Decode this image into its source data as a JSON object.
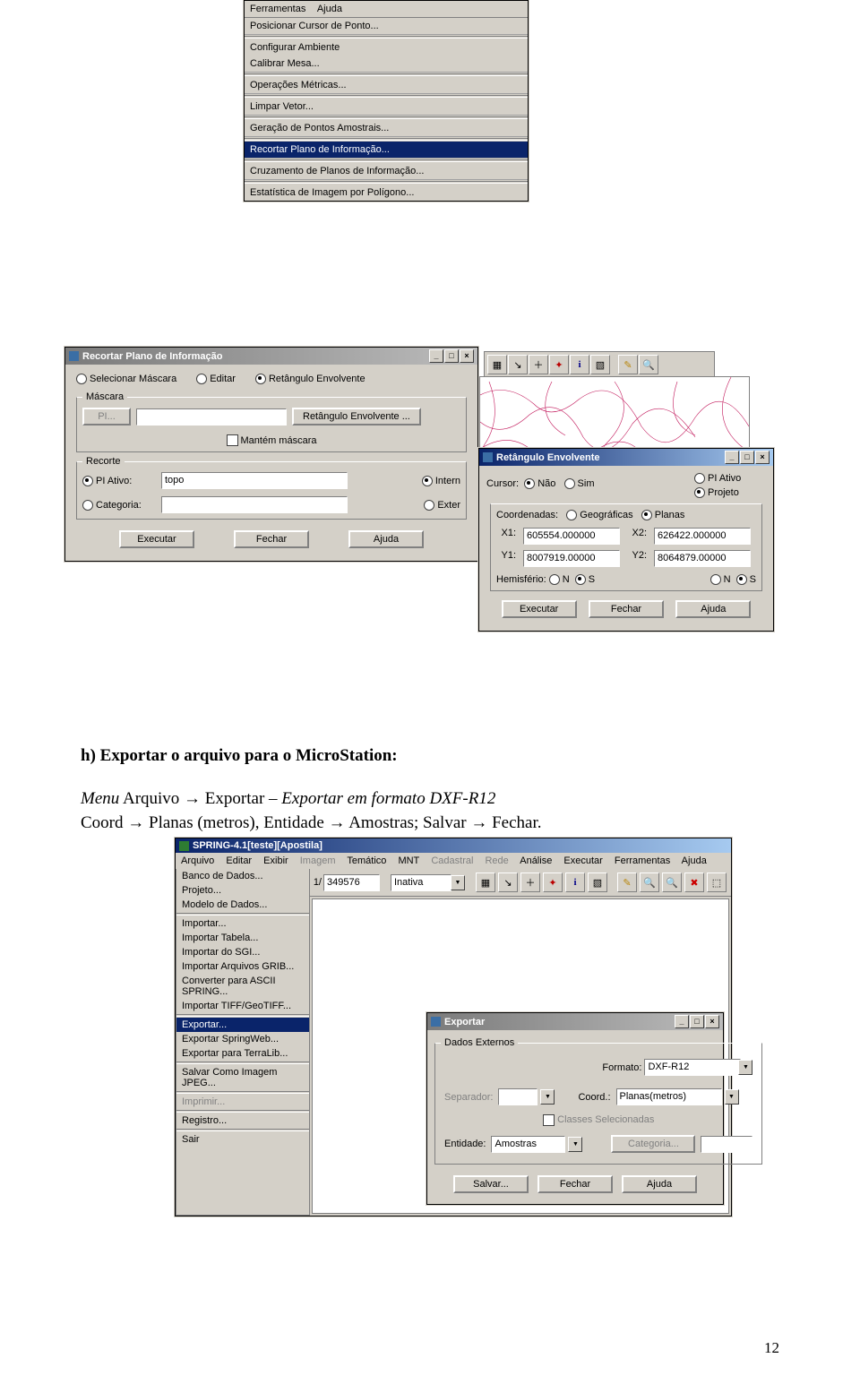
{
  "menu1": {
    "topbar": {
      "ferramentas": "Ferramentas",
      "ajuda": "Ajuda"
    },
    "items": [
      "Posicionar Cursor de Ponto...",
      "Configurar Ambiente",
      "Calibrar Mesa...",
      "Operações Métricas...",
      "Limpar Vetor...",
      "Geração de Pontos Amostrais...",
      "Recortar Plano de Informação...",
      "Cruzamento de Planos de Informação...",
      "Estatística de Imagem por Polígono..."
    ]
  },
  "dlgRecortar": {
    "title": "Recortar Plano de Informação",
    "radios": {
      "sel": "Selecionar Máscara",
      "edi": "Editar",
      "ret": "Retângulo Envolvente"
    },
    "mask": {
      "legend": "Máscara",
      "pi": "PI...",
      "retbtn": "Retângulo Envolvente ...",
      "keep": "Mantém máscara"
    },
    "recorte": {
      "legend": "Recorte",
      "piativo": "PI Ativo:",
      "piativo_val": "topo",
      "cat": "Categoria:",
      "cat_val": "",
      "interno": "Intern",
      "externo": "Exter"
    },
    "btns": {
      "ex": "Executar",
      "fe": "Fechar",
      "aj": "Ajuda"
    }
  },
  "dlgEnvolvente": {
    "title": "Retângulo Envolvente",
    "cursor": {
      "label": "Cursor:",
      "nao": "Não",
      "sim": "Sim"
    },
    "side": {
      "piativo": "PI Ativo",
      "projeto": "Projeto"
    },
    "coords": {
      "label": "Coordenadas:",
      "geo": "Geográficas",
      "pla": "Planas"
    },
    "x1": {
      "label": "X1:",
      "val": "605554.000000"
    },
    "x2": {
      "label": "X2:",
      "val": "626422.000000"
    },
    "y1": {
      "label": "Y1:",
      "val": "8007919.00000"
    },
    "y2": {
      "label": "Y2:",
      "val": "8064879.00000"
    },
    "hemi": {
      "label": "Hemisfério:",
      "n": "N",
      "s": "S"
    },
    "btns": {
      "ex": "Executar",
      "fe": "Fechar",
      "aj": "Ajuda"
    }
  },
  "body": {
    "h": "h) Exportar o arquivo para o MicroStation:",
    "l1a": "Menu",
    "l1b": " Arquivo → Exportar – ",
    "l1c": "Exportar em formato DXF-R12",
    "l2": "Coord → Planas (metros), Entidade → Amostras;  Salvar → Fechar."
  },
  "spring": {
    "title": "SPRING-4.1[teste][Apostila]",
    "menubar": [
      "Arquivo",
      "Editar",
      "Exibir",
      "Imagem",
      "Temático",
      "MNT",
      "Cadastral",
      "Rede",
      "Análise",
      "Executar",
      "Ferramentas",
      "Ajuda"
    ],
    "menu": {
      "items": [
        "Banco de Dados...",
        "Projeto...",
        "Modelo de Dados...",
        "",
        "Importar...",
        "Importar Tabela...",
        "Importar do SGI...",
        "Importar Arquivos GRIB...",
        "Converter para ASCII SPRING...",
        "Importar TIFF/GeoTIFF...",
        "",
        "Exportar...",
        "Exportar SpringWeb...",
        "Exportar para TerraLib...",
        "",
        "Salvar Como Imagem JPEG...",
        "",
        "Imprimir...",
        "",
        "Registro...",
        "",
        "Sair"
      ],
      "selected": "Exportar..."
    },
    "toolbar": {
      "scale": "1/",
      "scaleval": "349576",
      "combo": "Inativa"
    }
  },
  "dlgExport": {
    "title": "Exportar",
    "legend": "Dados Externos",
    "formato": {
      "label": "Formato:",
      "val": "DXF-R12"
    },
    "sep": {
      "label": "Separador:",
      "val": ""
    },
    "coord": {
      "label": "Coord.:",
      "val": "Planas(metros)"
    },
    "classes": "Classes Selecionadas",
    "entidade": {
      "label": "Entidade:",
      "val": "Amostras"
    },
    "categoria": {
      "label": "Categoria...",
      "val": ""
    },
    "btns": {
      "sa": "Salvar...",
      "fe": "Fechar",
      "aj": "Ajuda"
    }
  },
  "pagenum": "12"
}
